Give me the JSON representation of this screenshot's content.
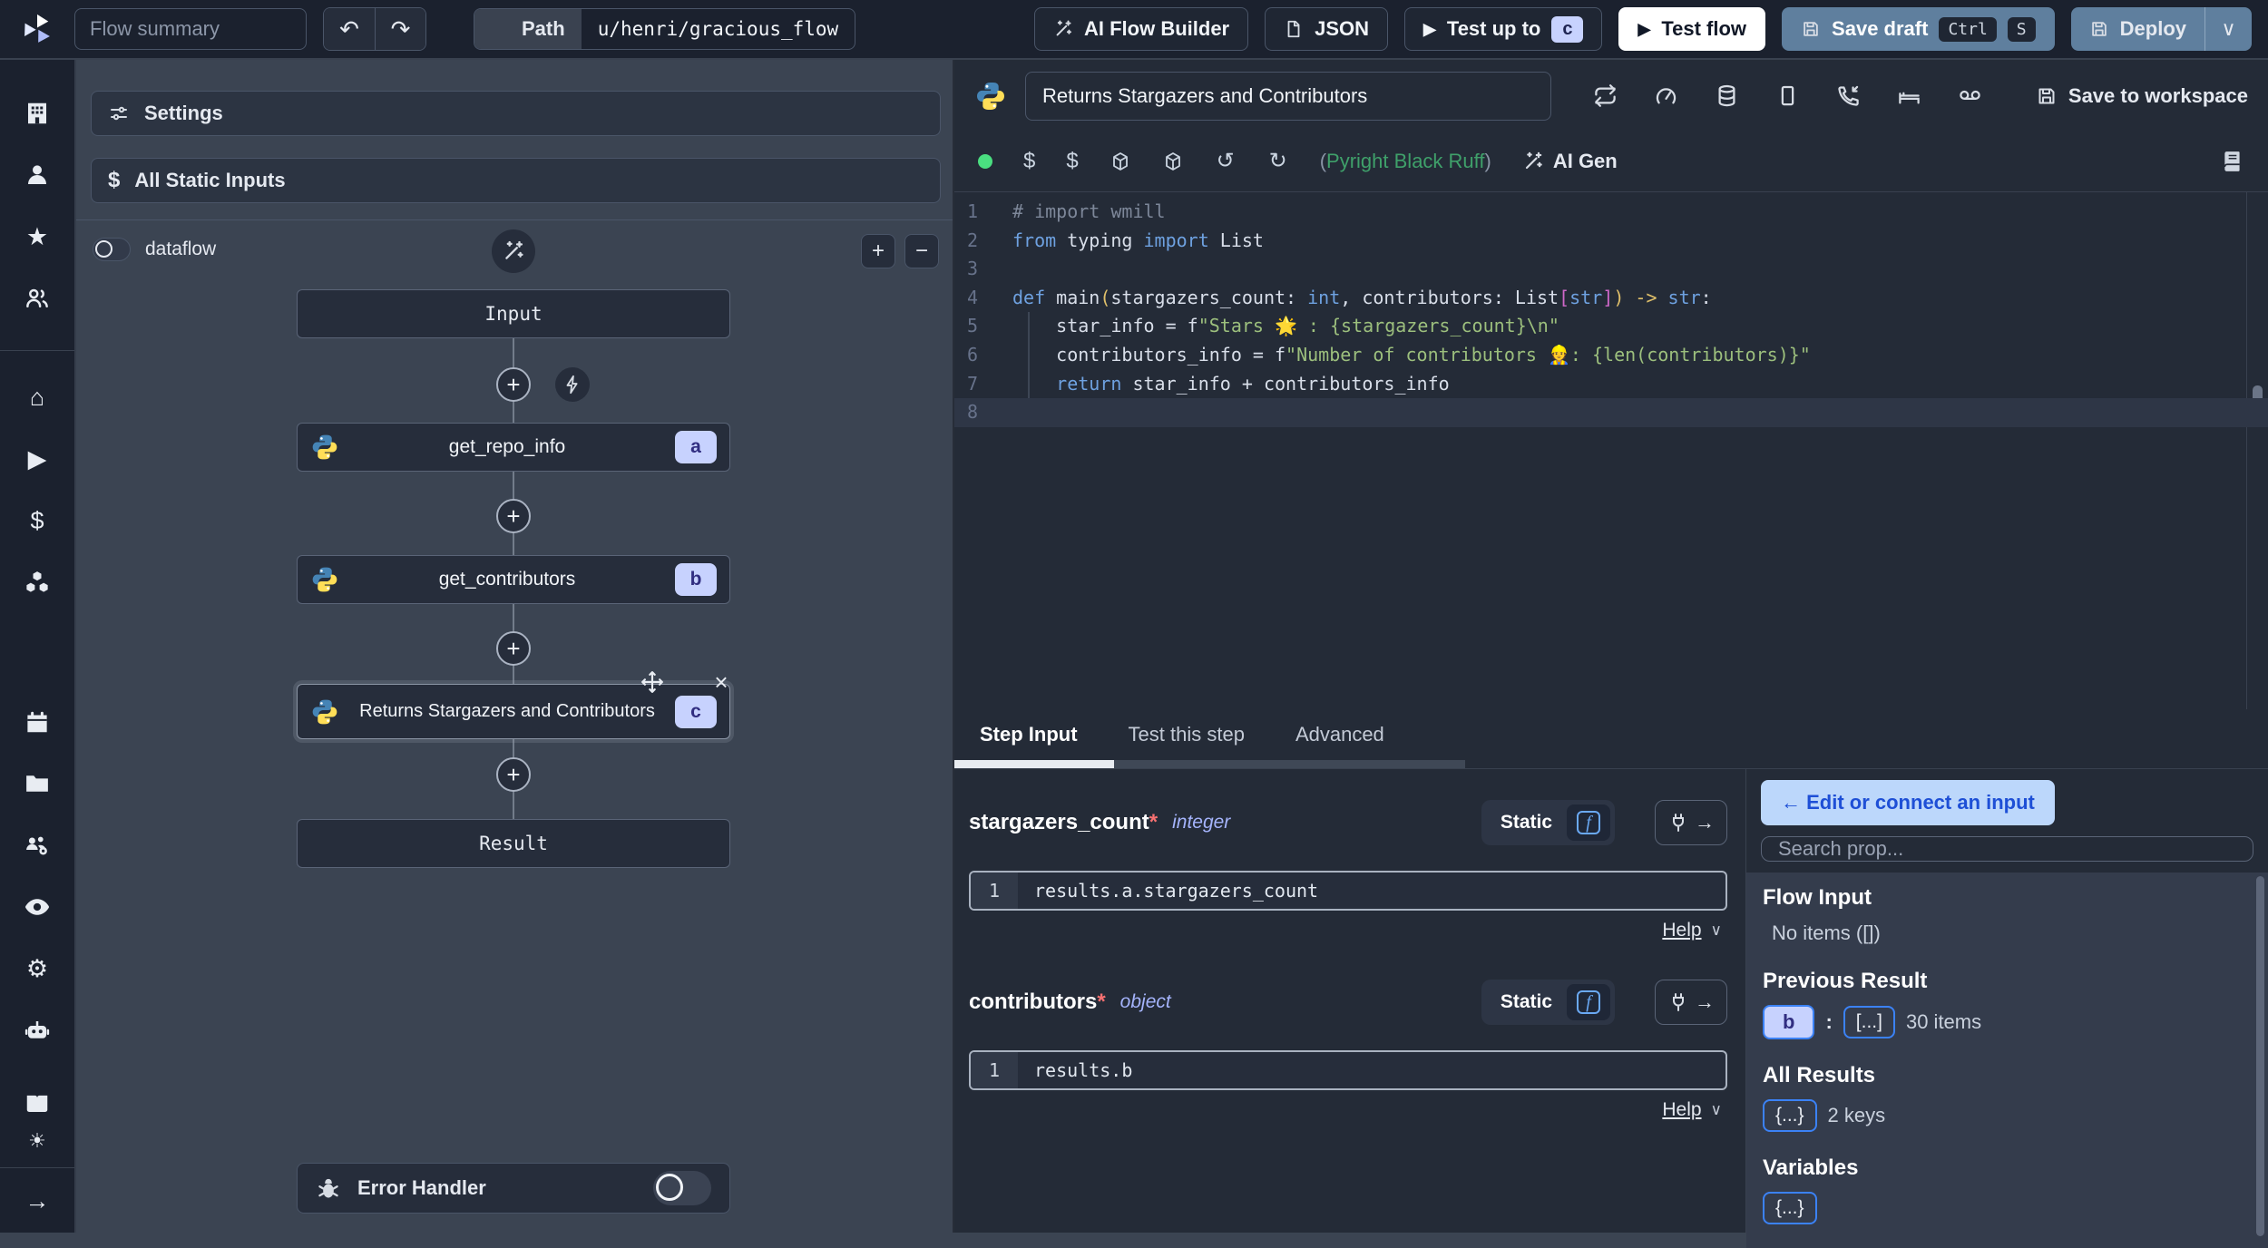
{
  "topbar": {
    "flow_summary_placeholder": "Flow summary",
    "path_label": "Path",
    "path_value": "u/henri/gracious_flow",
    "ai_flow_builder_label": "AI Flow Builder",
    "json_label": "JSON",
    "test_up_to_label": "Test up to",
    "test_up_to_badge": "c",
    "test_flow_label": "Test flow",
    "save_draft_label": "Save draft",
    "save_draft_shortcut": [
      "Ctrl",
      "S"
    ],
    "deploy_label": "Deploy"
  },
  "sidebar": {
    "icons": [
      "workspace-building",
      "user",
      "favorites-star",
      "groups-users",
      "home",
      "runs-play",
      "variables-dollar",
      "resources-cubes",
      "schedules-calendar",
      "folders",
      "workers-group",
      "audit-eye",
      "settings-gear",
      "ai-robot",
      "docs-book",
      "theme-sun",
      "expand-arrow"
    ]
  },
  "flow_panel": {
    "settings_label": "Settings",
    "all_static_inputs_label": "All Static Inputs",
    "dataflow_label": "dataflow",
    "nodes": {
      "input": "Input",
      "a": {
        "label": "get_repo_info",
        "badge": "a"
      },
      "b": {
        "label": "get_contributors",
        "badge": "b"
      },
      "c": {
        "label": "Returns Stargazers and Contributors",
        "badge": "c"
      },
      "result": "Result"
    },
    "error_handler_label": "Error Handler"
  },
  "editor": {
    "title": "Returns Stargazers and Contributors",
    "save_to_workspace_label": "Save to workspace",
    "header_icons": [
      "retries-repeat",
      "early-stop-gauge",
      "cache-database",
      "mock-square",
      "suspend-phone",
      "sleep-bed",
      "shared-dir-voicemail"
    ],
    "lint_open": "(",
    "lint_text": "Pyright Black Ruff",
    "lint_close": ")",
    "ai_gen_label": "AI Gen",
    "code": {
      "language": "python",
      "current_line": 8,
      "lines": [
        [
          {
            "c": "cm",
            "t": "# import wmill"
          }
        ],
        [
          {
            "c": "kw",
            "t": "from"
          },
          {
            "c": "tx",
            "t": " typing "
          },
          {
            "c": "kw",
            "t": "import"
          },
          {
            "c": "tx",
            "t": " List"
          }
        ],
        [],
        [
          {
            "c": "kw",
            "t": "def"
          },
          {
            "c": "tx",
            "t": " main"
          },
          {
            "c": "pa",
            "t": "("
          },
          {
            "c": "tx",
            "t": "stargazers_count: "
          },
          {
            "c": "kw",
            "t": "int"
          },
          {
            "c": "tx",
            "t": ", contributors: List"
          },
          {
            "c": "br",
            "t": "["
          },
          {
            "c": "kw",
            "t": "str"
          },
          {
            "c": "br",
            "t": "]"
          },
          {
            "c": "pa",
            "t": ")"
          },
          {
            "c": "tx",
            "t": " "
          },
          {
            "c": "pa",
            "t": "->"
          },
          {
            "c": "tx",
            "t": " "
          },
          {
            "c": "kw",
            "t": "str"
          },
          {
            "c": "tx",
            "t": ":"
          }
        ],
        [
          {
            "c": "tx",
            "t": "    star_info = f"
          },
          {
            "c": "st",
            "t": "\"Stars 🌟 : {stargazers_count}\\n\""
          }
        ],
        [
          {
            "c": "tx",
            "t": "    contributors_info = f"
          },
          {
            "c": "st",
            "t": "\"Number of contributors 👷: {len(contributors)}\""
          }
        ],
        [
          {
            "c": "kw",
            "t": "    return"
          },
          {
            "c": "tx",
            "t": " star_info + contributors_info"
          }
        ],
        []
      ]
    }
  },
  "tabs": {
    "items": [
      "Step Input",
      "Test this step",
      "Advanced"
    ],
    "active": "Step Input"
  },
  "fields": [
    {
      "name": "stargazers_count",
      "required": "*",
      "type": "integer",
      "mode": "Static",
      "line_no": "1",
      "expr": "results.a.stargazers_count",
      "help_label": "Help"
    },
    {
      "name": "contributors",
      "required": "*",
      "type": "object",
      "mode": "Static",
      "line_no": "1",
      "expr": "results.b",
      "help_label": "Help"
    }
  ],
  "props": {
    "edit_connect_label": "← Edit or connect an input",
    "search_placeholder": "Search prop...",
    "flow_input_title": "Flow Input",
    "flow_input_empty": "No items ([])",
    "previous_result_title": "Previous Result",
    "previous_result_key": "b",
    "previous_result_colon": ":",
    "previous_result_badge": "[...]",
    "previous_result_count": "30 items",
    "all_results_title": "All Results",
    "all_results_badge": "{...}",
    "all_results_count": "2 keys",
    "variables_title": "Variables",
    "variables_badge": "{...}"
  },
  "icons": {
    "undo": "↶",
    "redo": "↷",
    "chevron_down": "∨",
    "play": "▶",
    "plus": "+",
    "minus": "−",
    "close": "×",
    "home": "⌂",
    "star": "★",
    "gear": "⚙",
    "sun": "☀",
    "arrow_right": "→",
    "dollar": "$",
    "rotate_left": "↺",
    "rotate_right": "↻",
    "repeat": "⇄",
    "square": "▯"
  },
  "colors": {
    "accent_lavender": "#c7d2fe",
    "badge_text": "#312e81",
    "steel_blue": "#5f7f9e",
    "green_status": "#4ade80",
    "lint_green": "#3fa06a",
    "blue_border": "#3b82f6",
    "connect_bg": "#bcd7fb",
    "connect_text": "#1e4fd6",
    "required_red": "#f87171",
    "type_indigo": "#a5b4fc"
  }
}
